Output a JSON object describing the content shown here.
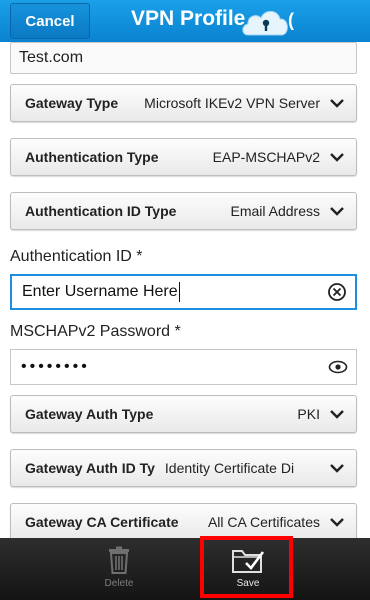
{
  "titlebar": {
    "cancel_label": "Cancel",
    "title": "VPN Profile",
    "title_clip": "(",
    "logo_icon": "vpn-cloud-lock-icon"
  },
  "form": {
    "server_address_value": "Test.com",
    "dropdowns": [
      {
        "label": "Gateway Type",
        "value": "Microsoft IKEv2 VPN Server"
      },
      {
        "label": "Authentication Type",
        "value": "EAP-MSCHAPv2"
      },
      {
        "label": "Authentication ID Type",
        "value": "Email Address"
      },
      {
        "label": "Gateway Auth Type",
        "value": "PKI"
      },
      {
        "label": "Gateway Auth ID Ty",
        "value": "Identity Certificate Di"
      },
      {
        "label": "Gateway CA Certificate",
        "value": "All CA Certificates"
      }
    ],
    "auth_id_label": "Authentication ID *",
    "auth_id_value": "Enter Username Here",
    "password_label": "MSCHAPv2 Password *",
    "password_value": "••••••••",
    "clear_icon": "clear-circle-icon",
    "reveal_icon": "eye-icon"
  },
  "actionbar": {
    "delete_label": "Delete",
    "save_label": "Save",
    "delete_icon": "trash-icon",
    "save_icon": "folder-check-icon"
  },
  "colors": {
    "titlebar": "#0a82d0",
    "focus_border": "#1d8fe0",
    "highlight": "#ff0000"
  }
}
